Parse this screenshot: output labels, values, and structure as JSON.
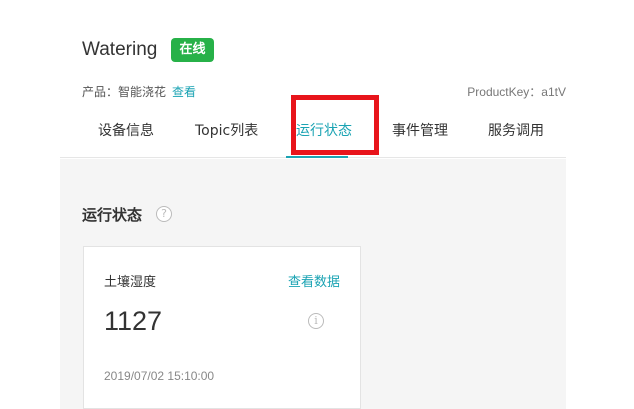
{
  "device": {
    "name": "Watering",
    "status": "在线",
    "product_label": "产品：智能浇花",
    "product_link": "查看",
    "product_key": "ProductKey：a1tV"
  },
  "tabs": [
    {
      "label": "设备信息"
    },
    {
      "label": "Topic列表"
    },
    {
      "label": "运行状态"
    },
    {
      "label": "事件管理"
    },
    {
      "label": "服务调用"
    }
  ],
  "section": {
    "title": "运行状态",
    "help": "?"
  },
  "card": {
    "label": "土壤湿度",
    "link": "查看数据",
    "value": "1127",
    "info": "i",
    "timestamp": "2019/07/02 15:10:00"
  },
  "colors": {
    "accent": "#1aa3b3",
    "online": "#27b148",
    "highlight": "#e8141b"
  }
}
